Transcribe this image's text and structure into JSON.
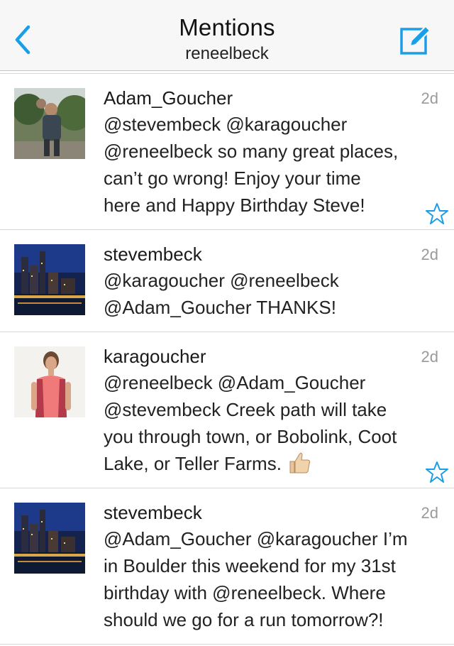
{
  "header": {
    "title": "Mentions",
    "subtitle": "reneelbeck"
  },
  "colors": {
    "accent": "#1a9ee6"
  },
  "tweets": [
    {
      "name": "Adam_Goucher",
      "time": "2d",
      "text": "@stevembeck @karagoucher\n@reneelbeck so many great places,\ncan’t go wrong!  Enjoy your time\nhere and Happy Birthday Steve!",
      "avatar": "person-outdoors-photo",
      "starred": false
    },
    {
      "name": "stevembeck",
      "time": "2d",
      "text": "@karagoucher @reneelbeck\n@Adam_Goucher THANKS!",
      "avatar": "city-night-photo",
      "starred": false
    },
    {
      "name": "karagoucher",
      "time": "2d",
      "text": "@reneelbeck @Adam_Goucher\n@stevembeck Creek path will take\nyou through town, or Bobolink, Coot\nLake, or Teller Farms.",
      "avatar": "runner-woman-photo",
      "emoji": "thumbs-up-icon",
      "starred": false
    },
    {
      "name": "stevembeck",
      "time": "2d",
      "text": "@Adam_Goucher @karagoucher I’m\nin Boulder this weekend for my 31st\nbirthday with @reneelbeck. Where\nshould we go for a run tomorrow?!",
      "avatar": "city-night-photo",
      "starred": false
    }
  ]
}
